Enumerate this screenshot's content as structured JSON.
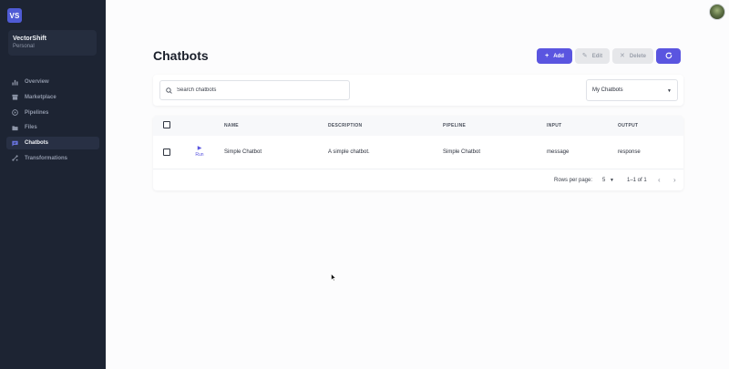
{
  "sidebar": {
    "logo_text": "VS",
    "org": {
      "name": "VectorShift",
      "type": "Personal"
    },
    "items": [
      {
        "label": "Overview",
        "icon": "bar-chart-icon",
        "active": false
      },
      {
        "label": "Marketplace",
        "icon": "store-icon",
        "active": false
      },
      {
        "label": "Pipelines",
        "icon": "play-circle-icon",
        "active": false
      },
      {
        "label": "Files",
        "icon": "folder-icon",
        "active": false
      },
      {
        "label": "Chatbots",
        "icon": "chat-icon",
        "active": true
      },
      {
        "label": "Transformations",
        "icon": "transform-icon",
        "active": false
      }
    ]
  },
  "header": {
    "title": "Chatbots",
    "buttons": {
      "add": "Add",
      "edit": "Edit",
      "delete": "Delete",
      "refresh_icon": "refresh-icon"
    }
  },
  "filters": {
    "search_placeholder": "Search chatbots",
    "select_value": "My Chatbots"
  },
  "table": {
    "columns": [
      "NAME",
      "DESCRIPTION",
      "PIPELINE",
      "INPUT",
      "OUTPUT"
    ],
    "rows": [
      {
        "run_label": "Run",
        "name": "Simple Chatbot",
        "description": "A simple chatbot.",
        "pipeline": "Simple Chatbot",
        "input": "message",
        "output": "response"
      }
    ],
    "pagination": {
      "rows_per_page_label": "Rows per page:",
      "rows_per_page_value": "5",
      "range": "1–1 of 1"
    }
  },
  "colors": {
    "sidebar_bg": "#1d2433",
    "accent": "#5a55e0",
    "disabled_btn": "#e6e7ea"
  }
}
